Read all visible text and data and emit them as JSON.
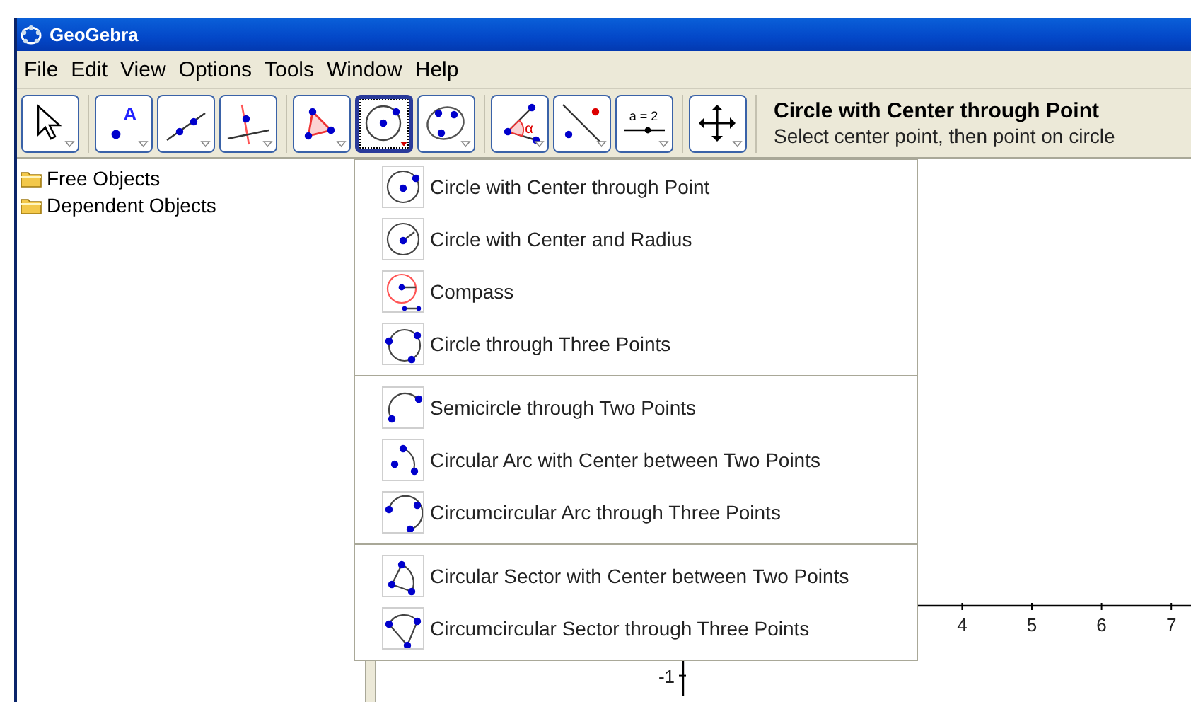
{
  "window": {
    "title": "GeoGebra"
  },
  "menu": [
    "File",
    "Edit",
    "View",
    "Options",
    "Tools",
    "Window",
    "Help"
  ],
  "toolbar": {
    "groups": [
      [
        {
          "kind": "move",
          "selected": false
        }
      ],
      [
        {
          "kind": "point",
          "label": "A",
          "selected": false
        },
        {
          "kind": "line",
          "selected": false
        },
        {
          "kind": "perpendicular",
          "selected": false
        }
      ],
      [
        {
          "kind": "polygon",
          "selected": false
        },
        {
          "kind": "circle-center",
          "selected": true
        },
        {
          "kind": "conic",
          "selected": false
        }
      ],
      [
        {
          "kind": "angle",
          "label": "α",
          "selected": false
        },
        {
          "kind": "reflect",
          "selected": false
        },
        {
          "kind": "slider",
          "label": "a = 2",
          "selected": false
        }
      ],
      [
        {
          "kind": "move-view",
          "selected": false
        }
      ]
    ],
    "help_title": "Circle with Center through Point",
    "help_text": "Select center point, then point on circle"
  },
  "algebra_view": {
    "folders": [
      "Free Objects",
      "Dependent Objects"
    ]
  },
  "graphics_view": {
    "x_tick_labels": [
      "4",
      "5",
      "6",
      "7"
    ],
    "y_tick_labels": [
      "-1"
    ]
  },
  "tool_menu": {
    "groups": [
      [
        {
          "kind": "circle-center",
          "label": "Circle with Center through Point"
        },
        {
          "kind": "circle-radius",
          "label": "Circle with Center and Radius"
        },
        {
          "kind": "compass",
          "label": "Compass"
        },
        {
          "kind": "circle-three",
          "label": "Circle through Three Points"
        }
      ],
      [
        {
          "kind": "semicircle",
          "label": "Semicircle through Two Points"
        },
        {
          "kind": "arc-center",
          "label": "Circular Arc with Center between Two Points"
        },
        {
          "kind": "arc-three",
          "label": "Circumcircular Arc through Three Points"
        }
      ],
      [
        {
          "kind": "sector-center",
          "label": "Circular Sector with Center between Two Points"
        },
        {
          "kind": "sector-three",
          "label": "Circumcircular Sector through Three Points"
        }
      ]
    ]
  }
}
